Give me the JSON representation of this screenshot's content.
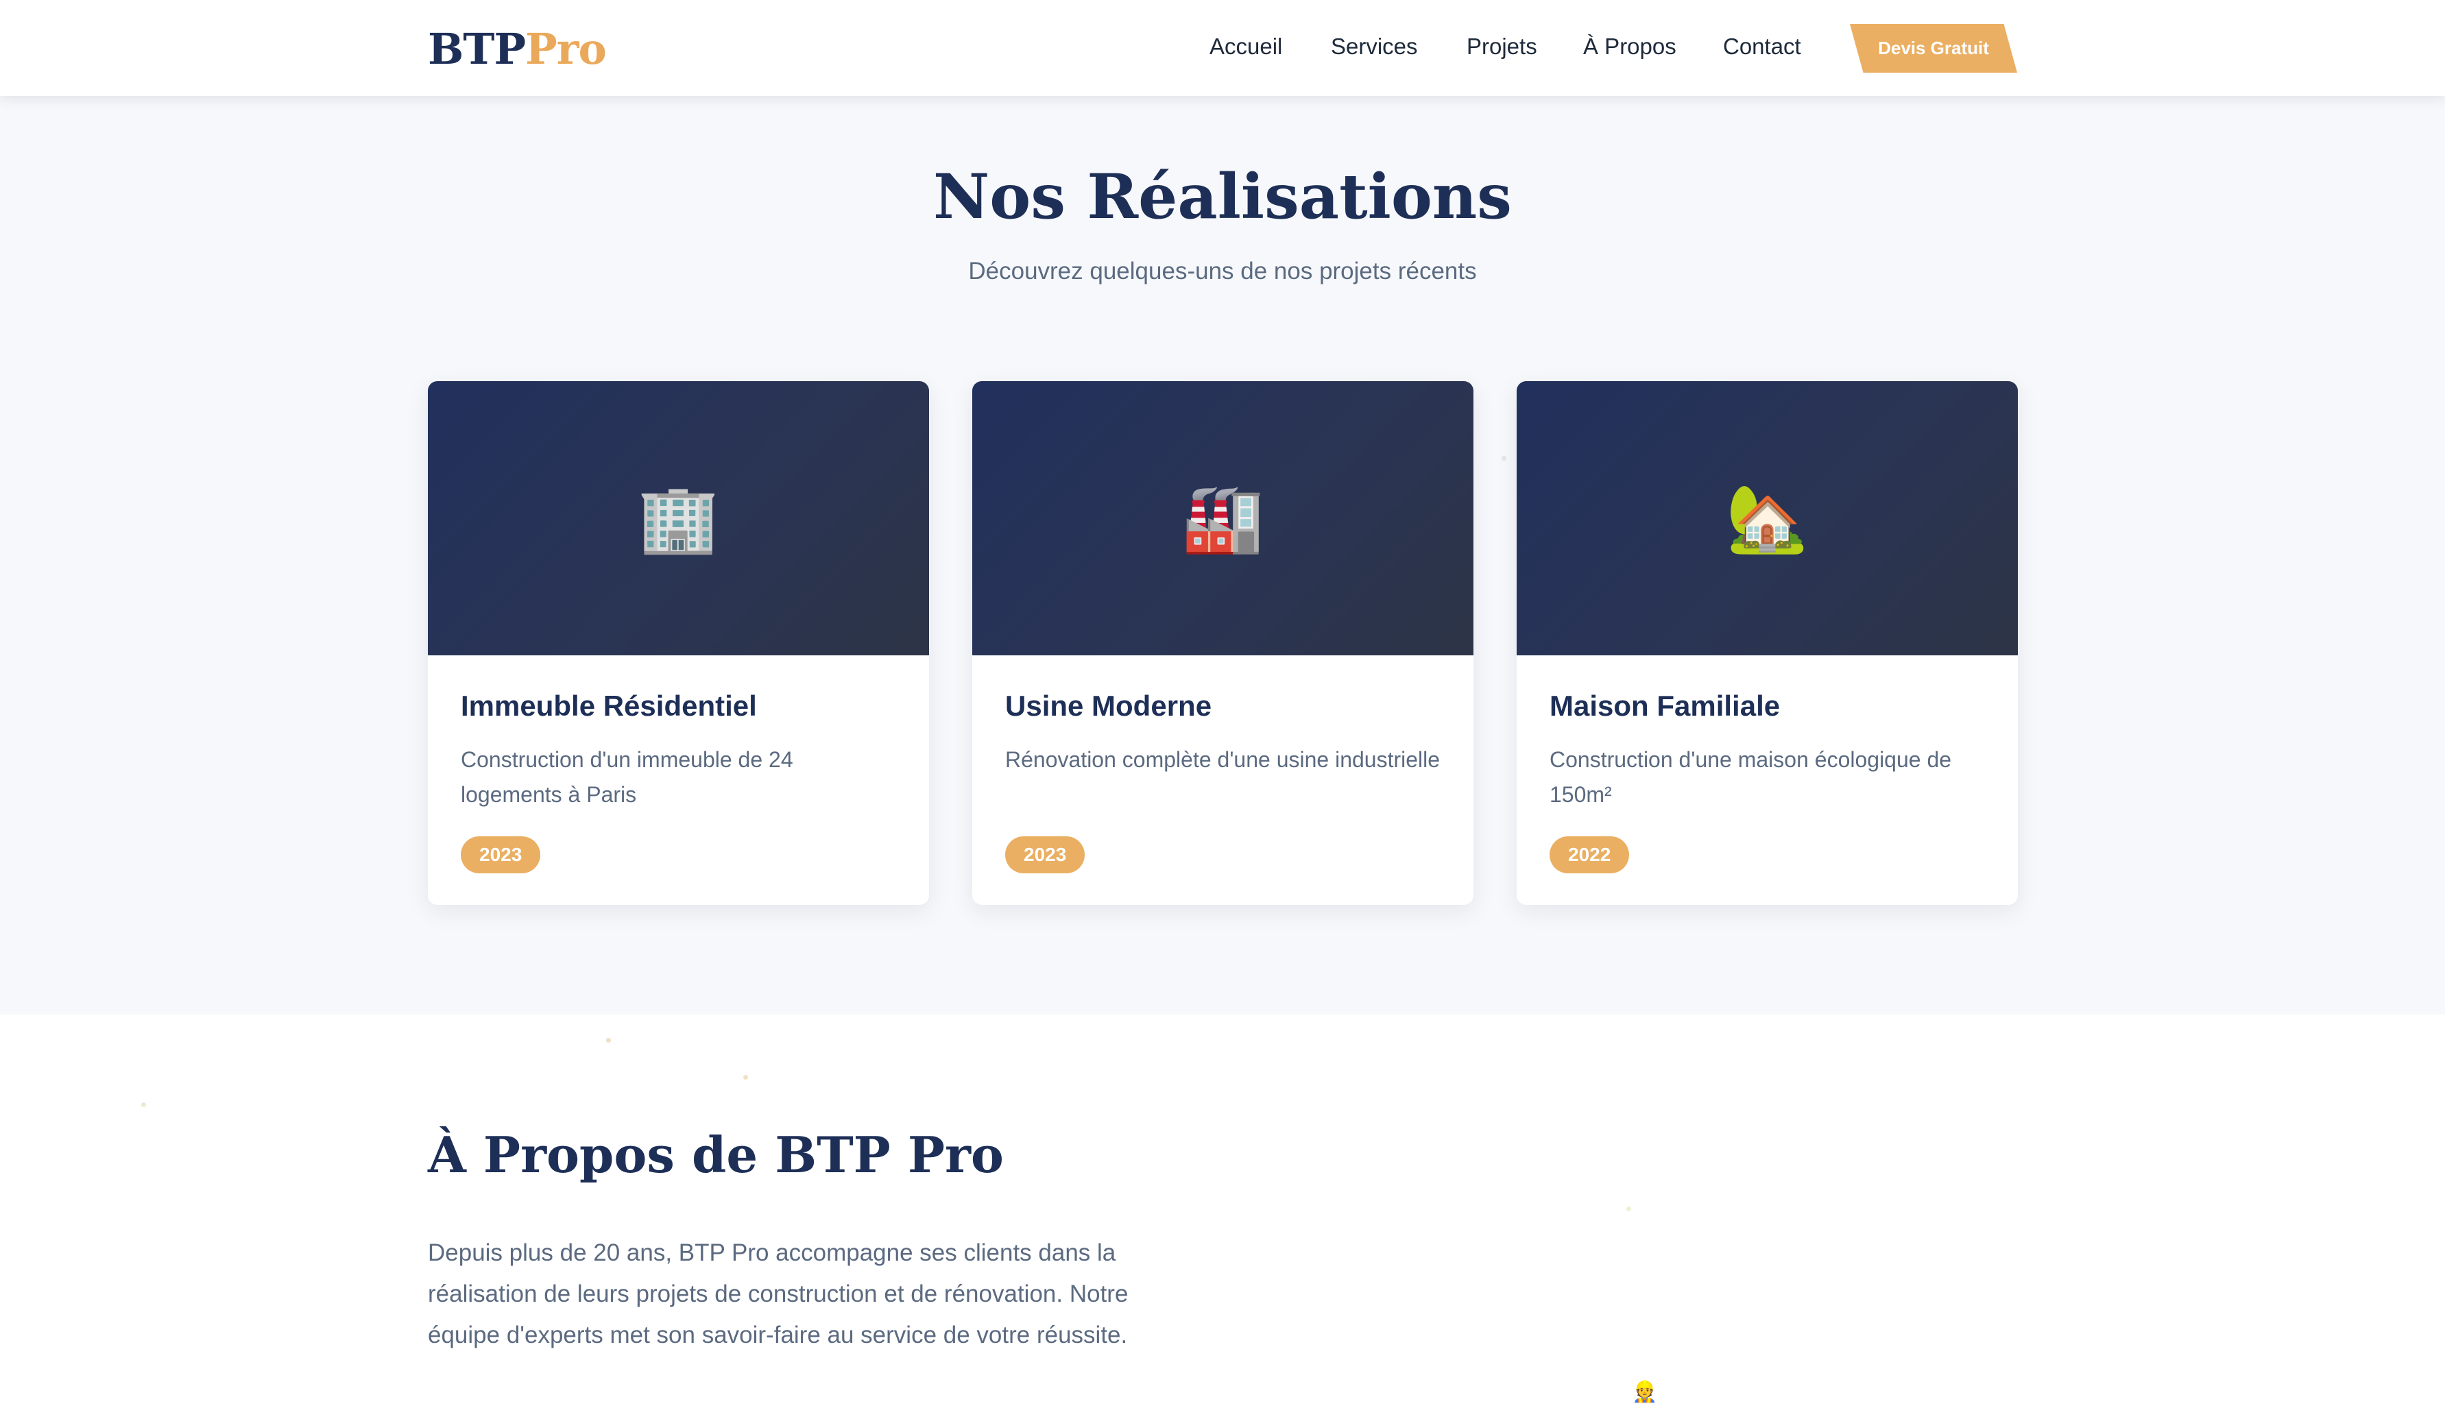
{
  "brand": {
    "part1": "BTP",
    "part2": "Pro"
  },
  "nav": {
    "items": [
      {
        "label": "Accueil"
      },
      {
        "label": "Services"
      },
      {
        "label": "Projets"
      },
      {
        "label": "À Propos"
      },
      {
        "label": "Contact"
      }
    ],
    "cta_label": "Devis Gratuit"
  },
  "realisations": {
    "title": "Nos Réalisations",
    "subtitle": "Découvrez quelques-uns de nos projets récents",
    "projects": [
      {
        "icon": "🏢",
        "icon_name": "office-building-icon",
        "title": "Immeuble Résidentiel",
        "description": "Construction d'un immeuble de 24 logements à Paris",
        "year": "2023"
      },
      {
        "icon": "🏭",
        "icon_name": "factory-icon",
        "title": "Usine Moderne",
        "description": "Rénovation complète d'une usine industrielle",
        "year": "2023"
      },
      {
        "icon": "🏡",
        "icon_name": "house-with-garden-icon",
        "title": "Maison Familiale",
        "description": "Construction d'une maison écologique de 150m²",
        "year": "2022"
      }
    ]
  },
  "about": {
    "title": "À Propos de BTP Pro",
    "text": "Depuis plus de 20 ans, BTP Pro accompagne ses clients dans la réalisation de leurs projets de construction et de rénovation. Notre équipe d'experts met son savoir-faire au service de votre réussite.",
    "icon": "👷",
    "icon_name": "construction-worker-icon"
  },
  "colors": {
    "navy": "#1e2f57",
    "accent": "#eaaf62",
    "muted_text": "#5b6a80",
    "section_bg": "#f6f8fb"
  }
}
